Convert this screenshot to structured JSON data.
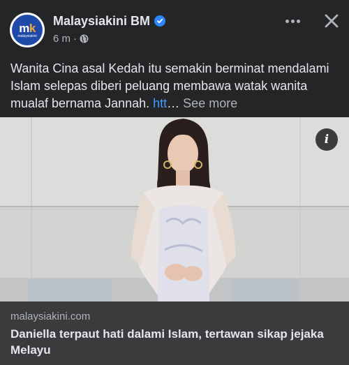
{
  "post": {
    "page_name": "Malaysiakini BM",
    "timestamp": "6 m",
    "avatar": {
      "mark_m": "m",
      "mark_k": "k",
      "subtext": "malaysiakini"
    },
    "caption": {
      "text": "Wanita Cina asal Kedah itu semakin berminat mendalami Islam selepas diberi peluang membawa watak wanita mualaf bernama Jannah. ",
      "link": "htt",
      "ellipsis": "…",
      "see_more": "See more"
    },
    "info_glyph": "i",
    "link_preview": {
      "domain": "malaysiakini.com",
      "headline": "Daniella terpaut hati dalami Islam, tertawan sikap jejaka Melayu"
    }
  },
  "icons": [
    "verified-badge-icon",
    "globe-icon",
    "more-options-icon",
    "close-icon",
    "info-icon"
  ],
  "colors": {
    "background": "#242526",
    "text": "#e4e6eb",
    "muted": "#b0b3b8",
    "link": "#4599ff",
    "verified": "#2d88ff",
    "footer": "#3a3b3c"
  }
}
